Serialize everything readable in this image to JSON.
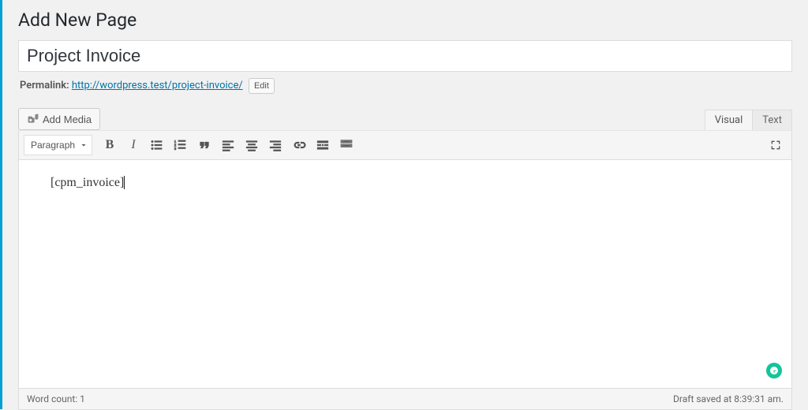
{
  "heading": "Add New Page",
  "title_value": "Project Invoice",
  "permalink": {
    "label": "Permalink:",
    "url_text": "http://wordpress.test/project-invoice/",
    "edit_label": "Edit"
  },
  "media_button": "Add Media",
  "tabs": {
    "visual": "Visual",
    "text": "Text"
  },
  "format_select": "Paragraph",
  "editor_body": "[cpm_invoice]",
  "status": {
    "word_count_label": "Word count: 1",
    "draft_saved_label": "Draft saved at 8:39:31 am."
  }
}
